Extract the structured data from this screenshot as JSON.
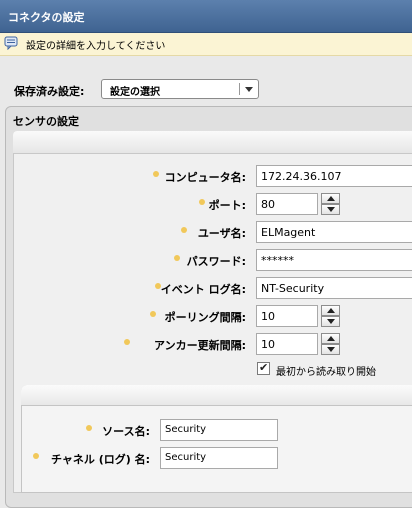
{
  "window": {
    "title": "コネクタの設定"
  },
  "info": {
    "text": "設定の詳細を入力してください"
  },
  "saved": {
    "label": "保存済み設定:",
    "selected": "設定の選択"
  },
  "sensor": {
    "title": "センサの設定",
    "fields": {
      "computer_name": {
        "label": "コンピュータ名:",
        "value": "172.24.36.107"
      },
      "port": {
        "label": "ポート:",
        "value": "80"
      },
      "username": {
        "label": "ユーザ名:",
        "value": "ELMagent"
      },
      "password": {
        "label": "パスワード:",
        "value": "******"
      },
      "event_log_name": {
        "label": "イベント ログ名:",
        "value": "NT-Security"
      },
      "polling_interval": {
        "label": "ポーリング間隔:",
        "value": "10"
      },
      "anchor_update_interval": {
        "label": "アンカー更新間隔:",
        "value": "10"
      }
    },
    "read_from_start": {
      "label": "最初から読み取り開始",
      "checked": true
    }
  },
  "source": {
    "source_name": {
      "label": "ソース名:",
      "value": "Security"
    },
    "channel_log_name": {
      "label": "チャネル (ログ) 名:",
      "value": "Security"
    }
  },
  "colors": {
    "titlebar": "#4a6e9c",
    "bullet": "#f1c85a",
    "infobar": "#fbf4d4"
  }
}
